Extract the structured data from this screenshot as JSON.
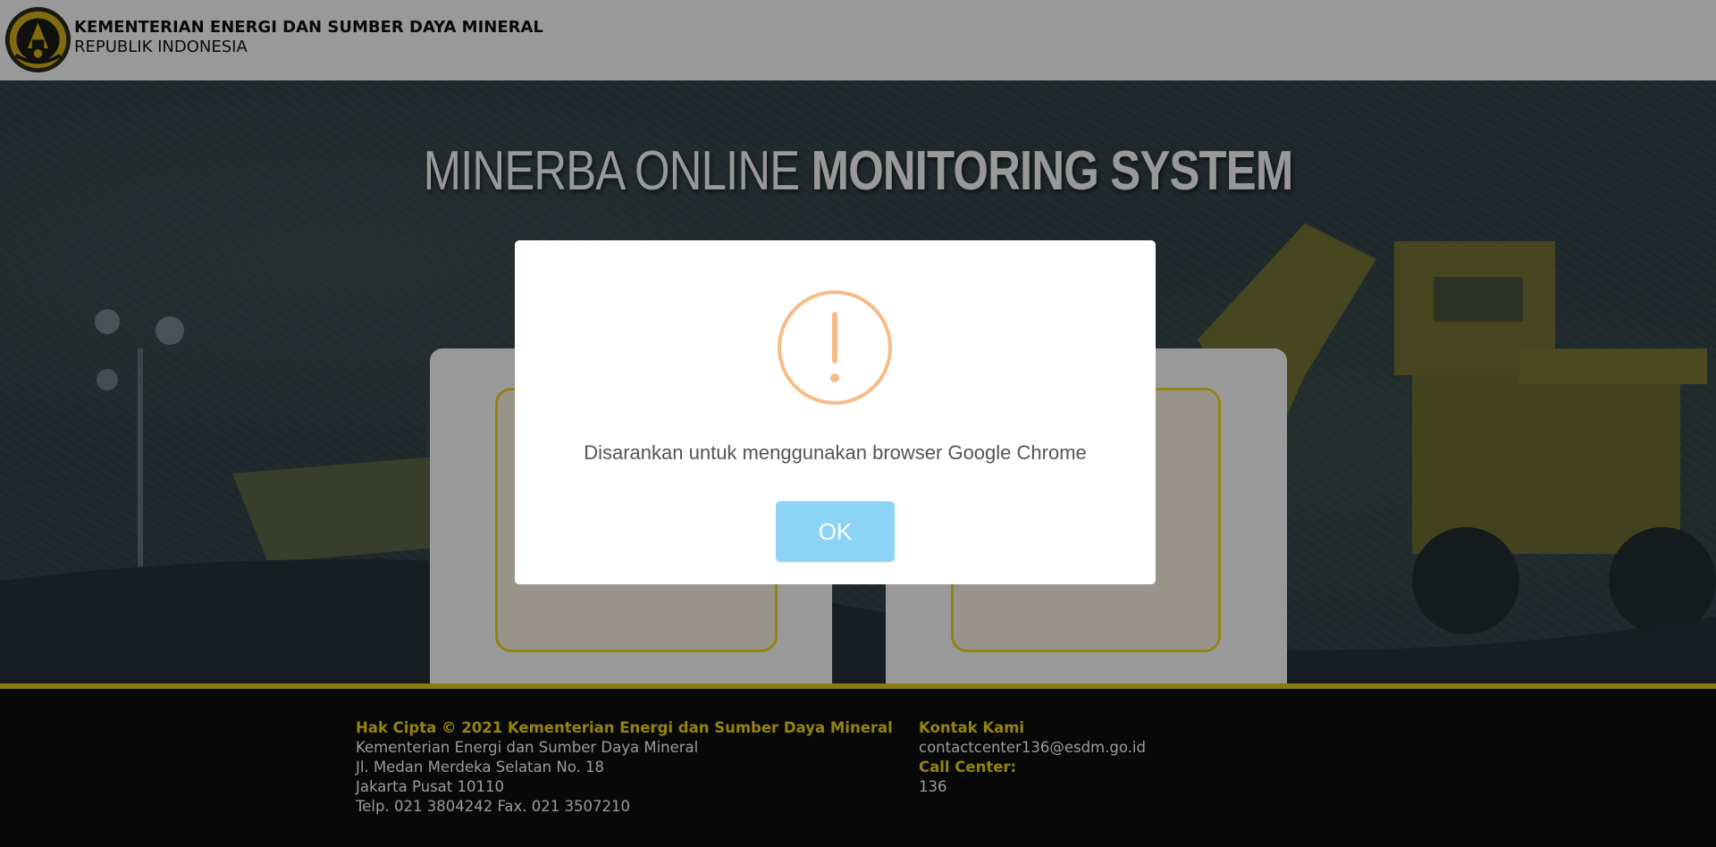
{
  "header": {
    "ministry_name": "KEMENTERIAN ENERGI DAN SUMBER DAYA MINERAL",
    "ministry_sub": "REPUBLIK INDONESIA",
    "logo_icon": "esdm-emblem-icon"
  },
  "hero": {
    "title_light": "MINERBA ONLINE",
    "title_bold": "MONITORING SYSTEM"
  },
  "footer": {
    "left": {
      "copyright": "Hak Cipta © 2021 Kementerian Energi dan Sumber Daya Mineral",
      "org": "Kementerian Energi dan Sumber Daya Mineral",
      "address1": "Jl. Medan Merdeka Selatan No. 18",
      "address2": "Jakarta Pusat 10110",
      "phone": "Telp. 021 3804242 Fax. 021 3507210"
    },
    "right": {
      "contact_heading": "Kontak Kami",
      "email": "contactcenter136@esdm.go.id",
      "callcenter_heading": "Call Center:",
      "callcenter_number": "136"
    }
  },
  "modal": {
    "icon": "warning-icon",
    "message": "Disarankan untuk menggunakan browser Google Chrome",
    "ok_label": "OK"
  },
  "colors": {
    "accent_yellow": "#f6dc1a",
    "ok_button": "#8cd4f5",
    "warning_icon": "#f8bb86"
  }
}
